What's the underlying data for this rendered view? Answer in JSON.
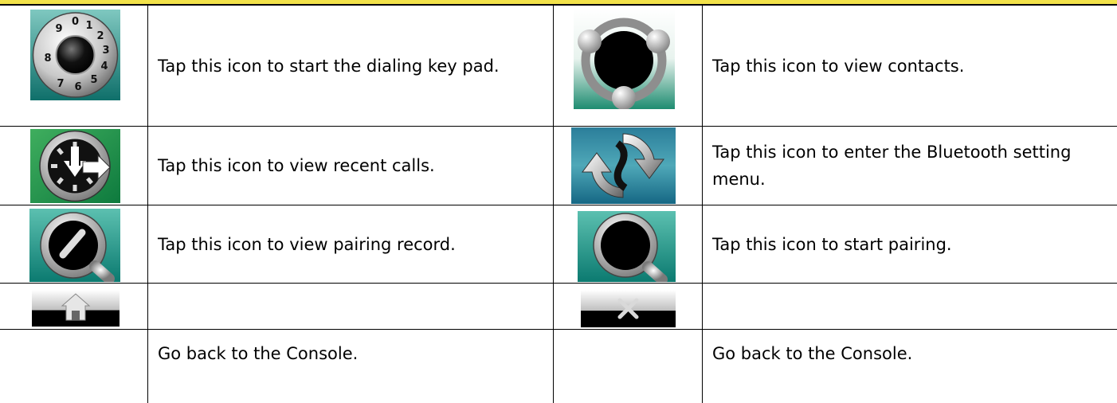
{
  "rows": [
    {
      "left": {
        "icon": "dial-keypad-icon",
        "text": "Tap this icon to start the dialing key pad."
      },
      "right": {
        "icon": "contacts-icon",
        "text": "Tap this icon to view contacts."
      }
    },
    {
      "left": {
        "icon": "recent-calls-icon",
        "text": "Tap this icon to view recent calls."
      },
      "right": {
        "icon": "bluetooth-settings-icon",
        "text": "Tap this icon to enter the Bluetooth setting menu."
      }
    },
    {
      "left": {
        "icon": "pairing-record-icon",
        "text": "Tap this icon to view pairing record."
      },
      "right": {
        "icon": "start-pairing-icon",
        "text": "Tap this icon to start pairing."
      }
    },
    {
      "left": {
        "icon": "home-icon",
        "text": "Go back to the Console."
      },
      "right": {
        "icon": "close-icon",
        "text": "Go back to the Console."
      }
    }
  ],
  "keypad_digits": [
    "0",
    "1",
    "2",
    "3",
    "4",
    "5",
    "6",
    "7",
    "8",
    "9"
  ],
  "colors": {
    "top_bar": "#f2e24a",
    "teal": "#1f8a86",
    "green": "#2aa05a"
  }
}
